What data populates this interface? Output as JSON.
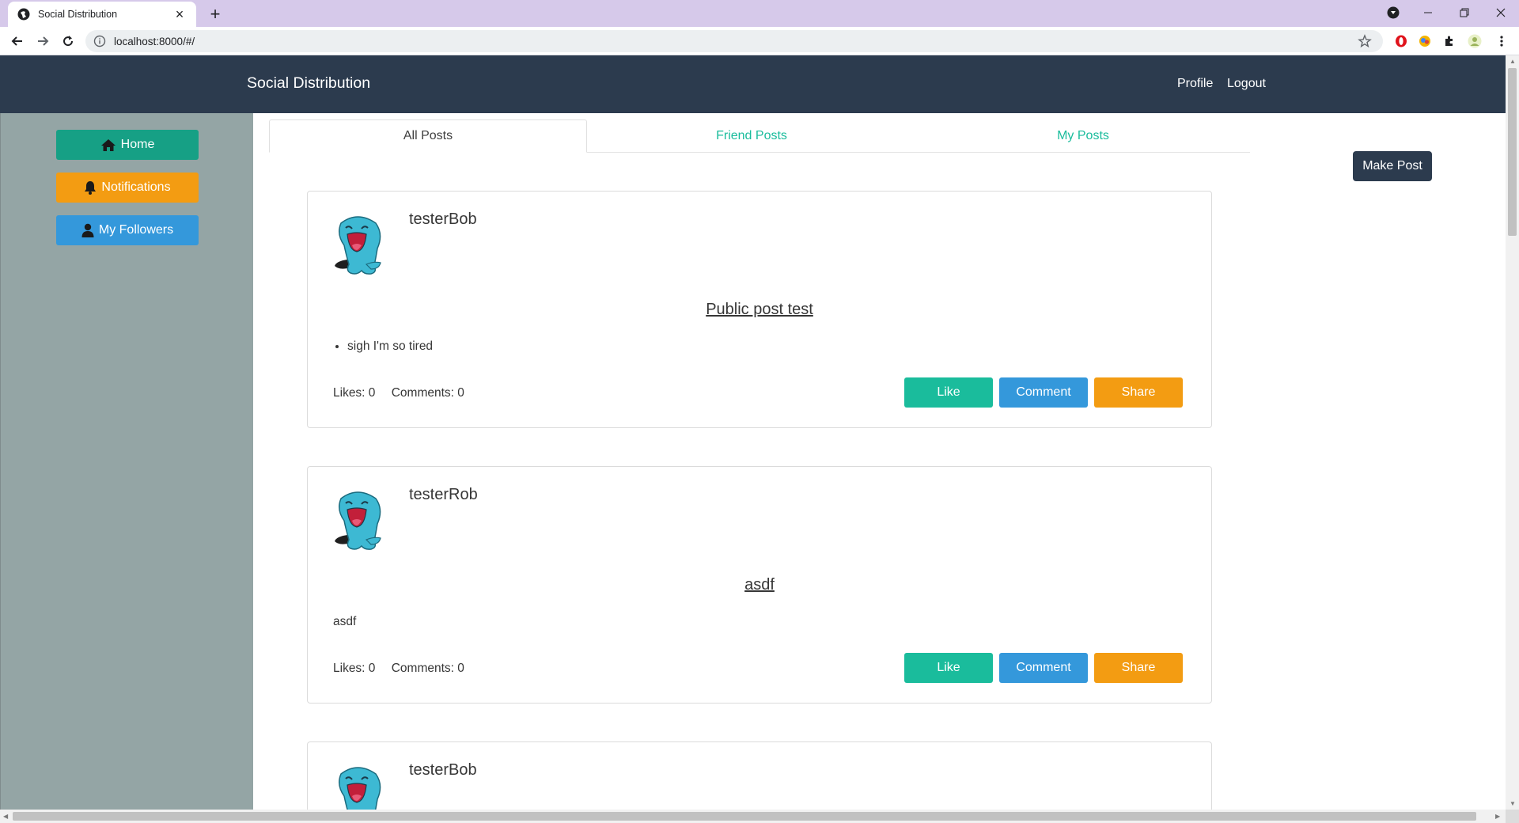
{
  "browser": {
    "tab_title": "Social Distribution",
    "url": "localhost:8000/#/",
    "icons": [
      "globe-icon",
      "close-icon",
      "plus-icon",
      "back-icon",
      "forward-icon",
      "reload-icon",
      "info-icon",
      "star-icon",
      "extensions-icon",
      "profile-icon",
      "more-icon"
    ]
  },
  "app": {
    "brand": "Social Distribution",
    "nav": {
      "profile": "Profile",
      "logout": "Logout"
    },
    "colors": {
      "navbar": "#2c3b4e",
      "sidebar": "#94a5a5",
      "teal": "#1abc9c",
      "blue": "#3498db",
      "orange": "#f39c12"
    }
  },
  "sidebar": {
    "home": "Home",
    "notifications": "Notifications",
    "followers": "My Followers"
  },
  "tabs": {
    "all": "All Posts",
    "friend": "Friend Posts",
    "mine": "My Posts",
    "active": "All Posts"
  },
  "make_post": "Make Post",
  "buttons": {
    "like": "Like",
    "comment": "Comment",
    "share": "Share"
  },
  "posts": [
    {
      "author": "testerBob",
      "title": "Public post test",
      "content": "sigh I'm so tired",
      "content_is_list": true,
      "likes": "Likes: 0",
      "comments": "Comments: 0"
    },
    {
      "author": "testerRob",
      "title": "asdf",
      "content": "asdf",
      "content_is_list": false,
      "likes": "Likes: 0",
      "comments": "Comments: 0"
    },
    {
      "author": "testerBob"
    }
  ]
}
